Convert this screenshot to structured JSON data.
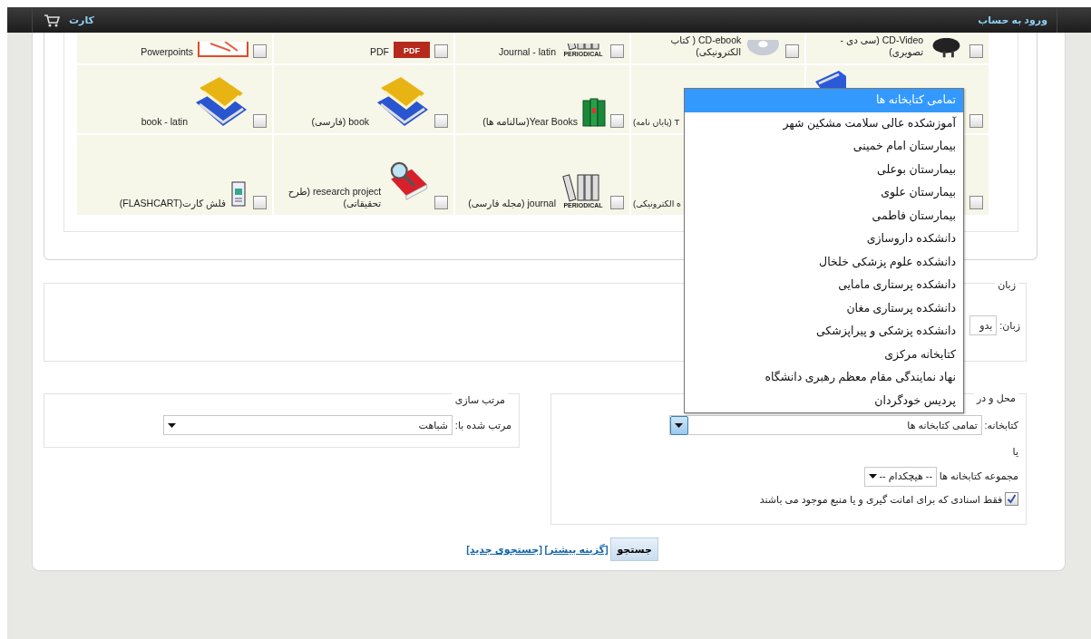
{
  "top_bar": {
    "login_link": "ورود به حساب",
    "cart_link": "کارت"
  },
  "material_types": {
    "rows": [
      [
        {
          "kind": "video",
          "label": "CD-Video (سی دی - تصویری)",
          "checked": false
        },
        {
          "kind": "disc",
          "label": "CD-ebook ( کتاب الکترونیکی)",
          "checked": false
        },
        {
          "kind": "periodical",
          "icon_text": "PERIODICAL",
          "label": "Journal - latin",
          "checked": false
        },
        {
          "kind": "pdf",
          "icon_text": "PDF",
          "label": "PDF",
          "checked": false
        },
        {
          "kind": "slides",
          "label": "Powerpoints",
          "checked": false
        }
      ],
      [
        {
          "kind": "partial-book",
          "checked": false
        },
        {
          "kind": "fragment",
          "label": "T (پایان نامه)"
        },
        {
          "kind": "binders",
          "label": "Year Books(سالنامه ها)",
          "checked": false
        },
        {
          "kind": "books",
          "label": "book (فارسی)",
          "checked": false
        },
        {
          "kind": "books",
          "label": "book - latin",
          "checked": false
        }
      ],
      [
        {
          "kind": "fragment",
          "checked": false
        },
        {
          "kind": "fragment",
          "label": "ه الکترونیکی)"
        },
        {
          "kind": "periodical",
          "icon_text": "PERIODICAL",
          "label": "journal (مجله فارسی)",
          "checked": false
        },
        {
          "kind": "research",
          "label": "research project (طرح تحقیقاتی)",
          "checked": false
        },
        {
          "kind": "flashcard",
          "label": "فلش کارت(FLASHCART)",
          "checked": false
        }
      ]
    ]
  },
  "language": {
    "legend": "زبان",
    "label": "زبان:",
    "value": "بدو"
  },
  "location": {
    "legend": "محل و در",
    "library": {
      "label": "کتابخانه:",
      "value": "تمامی کتابخانه ها",
      "expanded": true,
      "options": [
        {
          "text": "تمامی کتابخانه ها",
          "selected": true
        },
        {
          "text": "آموزشکده عالی سلامت مشکین شهر",
          "selected": false
        },
        {
          "text": "بیمارستان امام خمینی",
          "selected": false
        },
        {
          "text": "بیمارستان بوعلی",
          "selected": false
        },
        {
          "text": "بیمارستان علوی",
          "selected": false
        },
        {
          "text": "بیمارستان فاطمی",
          "selected": false
        },
        {
          "text": "دانشکده داروسازی",
          "selected": false
        },
        {
          "text": "دانشکده علوم پزشکی خلخال",
          "selected": false
        },
        {
          "text": "دانشکده پرستاری مامایی",
          "selected": false
        },
        {
          "text": "دانشکده پرستاری مغان",
          "selected": false
        },
        {
          "text": "دانشکده پزشکی و پیراپزشکی",
          "selected": false
        },
        {
          "text": "کتابخانه مرکزی",
          "selected": false
        },
        {
          "text": "نهاد نمایندگی مقام معظم رهبری دانشگاه",
          "selected": false
        },
        {
          "text": "پردیس خودگردان",
          "selected": false
        }
      ]
    },
    "or_text": "یا",
    "collection": {
      "label": "مجموعه کتابخانه ها",
      "value": "-- هیچکدام --"
    },
    "available_only": {
      "label": "فقط اسنادی که برای امانت گیری و یا منبع موجود می باشند",
      "checked": true
    }
  },
  "sorting": {
    "legend": "مرتب سازی",
    "label": "مرتب شده با:",
    "value": "شباهت"
  },
  "actions": {
    "search_button": "جستجو",
    "links": [
      "[گزینه بیشتر]",
      "[جستجوی جدید]"
    ]
  }
}
